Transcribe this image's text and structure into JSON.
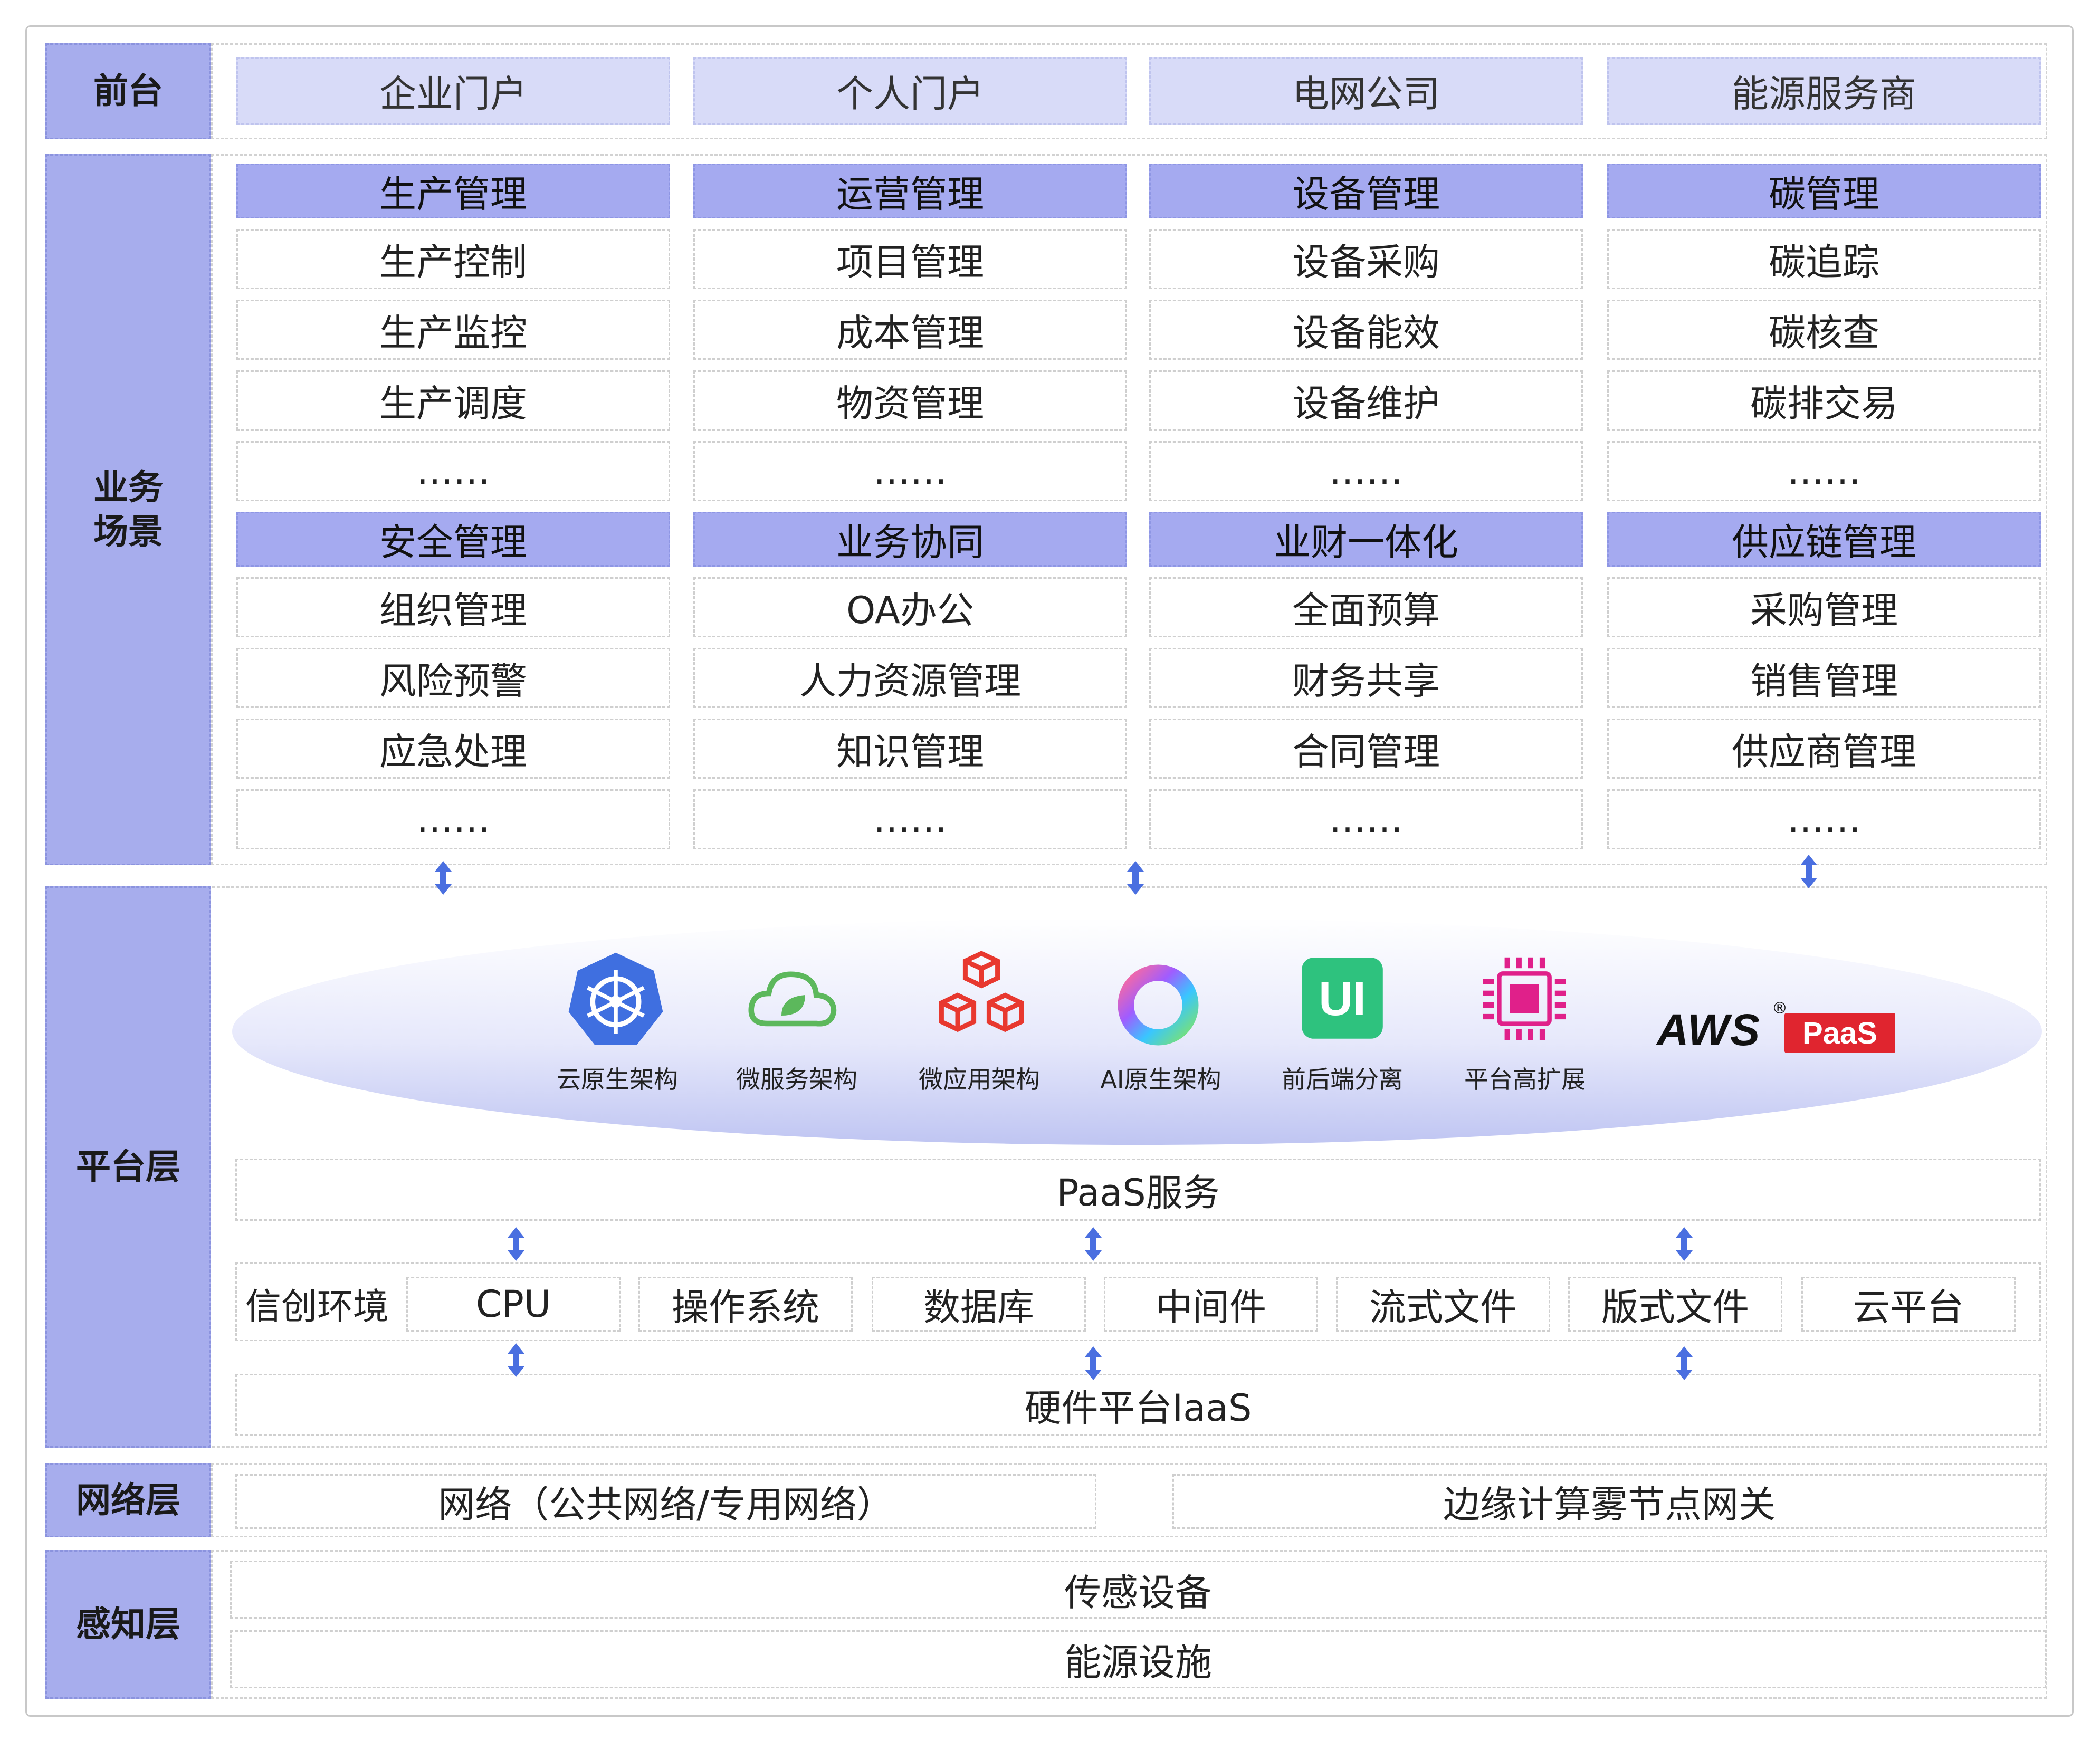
{
  "layers": {
    "front": "前台",
    "business": "业务\n场景",
    "platform": "平台层",
    "network": "网络层",
    "perception": "感知层"
  },
  "front_items": [
    "企业门户",
    "个人门户",
    "电网公司",
    "能源服务商"
  ],
  "business_groups": [
    {
      "title": "生产管理",
      "items": [
        "生产控制",
        "生产监控",
        "生产调度",
        "……"
      ]
    },
    {
      "title": "运营管理",
      "items": [
        "项目管理",
        "成本管理",
        "物资管理",
        "……"
      ]
    },
    {
      "title": "设备管理",
      "items": [
        "设备采购",
        "设备能效",
        "设备维护",
        "……"
      ]
    },
    {
      "title": "碳管理",
      "items": [
        "碳追踪",
        "碳核查",
        "碳排交易",
        "……"
      ]
    },
    {
      "title": "安全管理",
      "items": [
        "组织管理",
        "风险预警",
        "应急处理",
        "……"
      ]
    },
    {
      "title": "业务协同",
      "items": [
        "OA办公",
        "人力资源管理",
        "知识管理",
        "……"
      ]
    },
    {
      "title": "业财一体化",
      "items": [
        "全面预算",
        "财务共享",
        "合同管理",
        "……"
      ]
    },
    {
      "title": "供应链管理",
      "items": [
        "采购管理",
        "销售管理",
        "供应商管理",
        "……"
      ]
    }
  ],
  "tech": [
    {
      "label": "云原生架构",
      "icon": "kubernetes-icon"
    },
    {
      "label": "微服务架构",
      "icon": "spring-leaf-icon"
    },
    {
      "label": "微应用架构",
      "icon": "cubes-icon"
    },
    {
      "label": "AI原生架构",
      "icon": "ai-ring-icon"
    },
    {
      "label": "前后端分离",
      "icon": "ui-icon"
    },
    {
      "label": "平台高扩展",
      "icon": "chip-icon"
    }
  ],
  "aws": {
    "brand": "AWS",
    "reg": "®",
    "paas": "PaaS"
  },
  "paas_service": "PaaS服务",
  "xinchuang": {
    "label": "信创环境",
    "items": [
      "CPU",
      "操作系统",
      "数据库",
      "中间件",
      "流式文件",
      "版式文件",
      "云平台"
    ]
  },
  "iaas": "硬件平台IaaS",
  "network_items": [
    "网络（公共网络/专用网络）",
    "边缘计算雾节点网关"
  ],
  "perception_items": [
    "传感设备",
    "能源设施"
  ],
  "colors": {
    "label_bg": "#a7aded",
    "header_bg": "#a5aaf0",
    "front_bg": "#d8dbf8",
    "arrow": "#4a6fe0"
  }
}
